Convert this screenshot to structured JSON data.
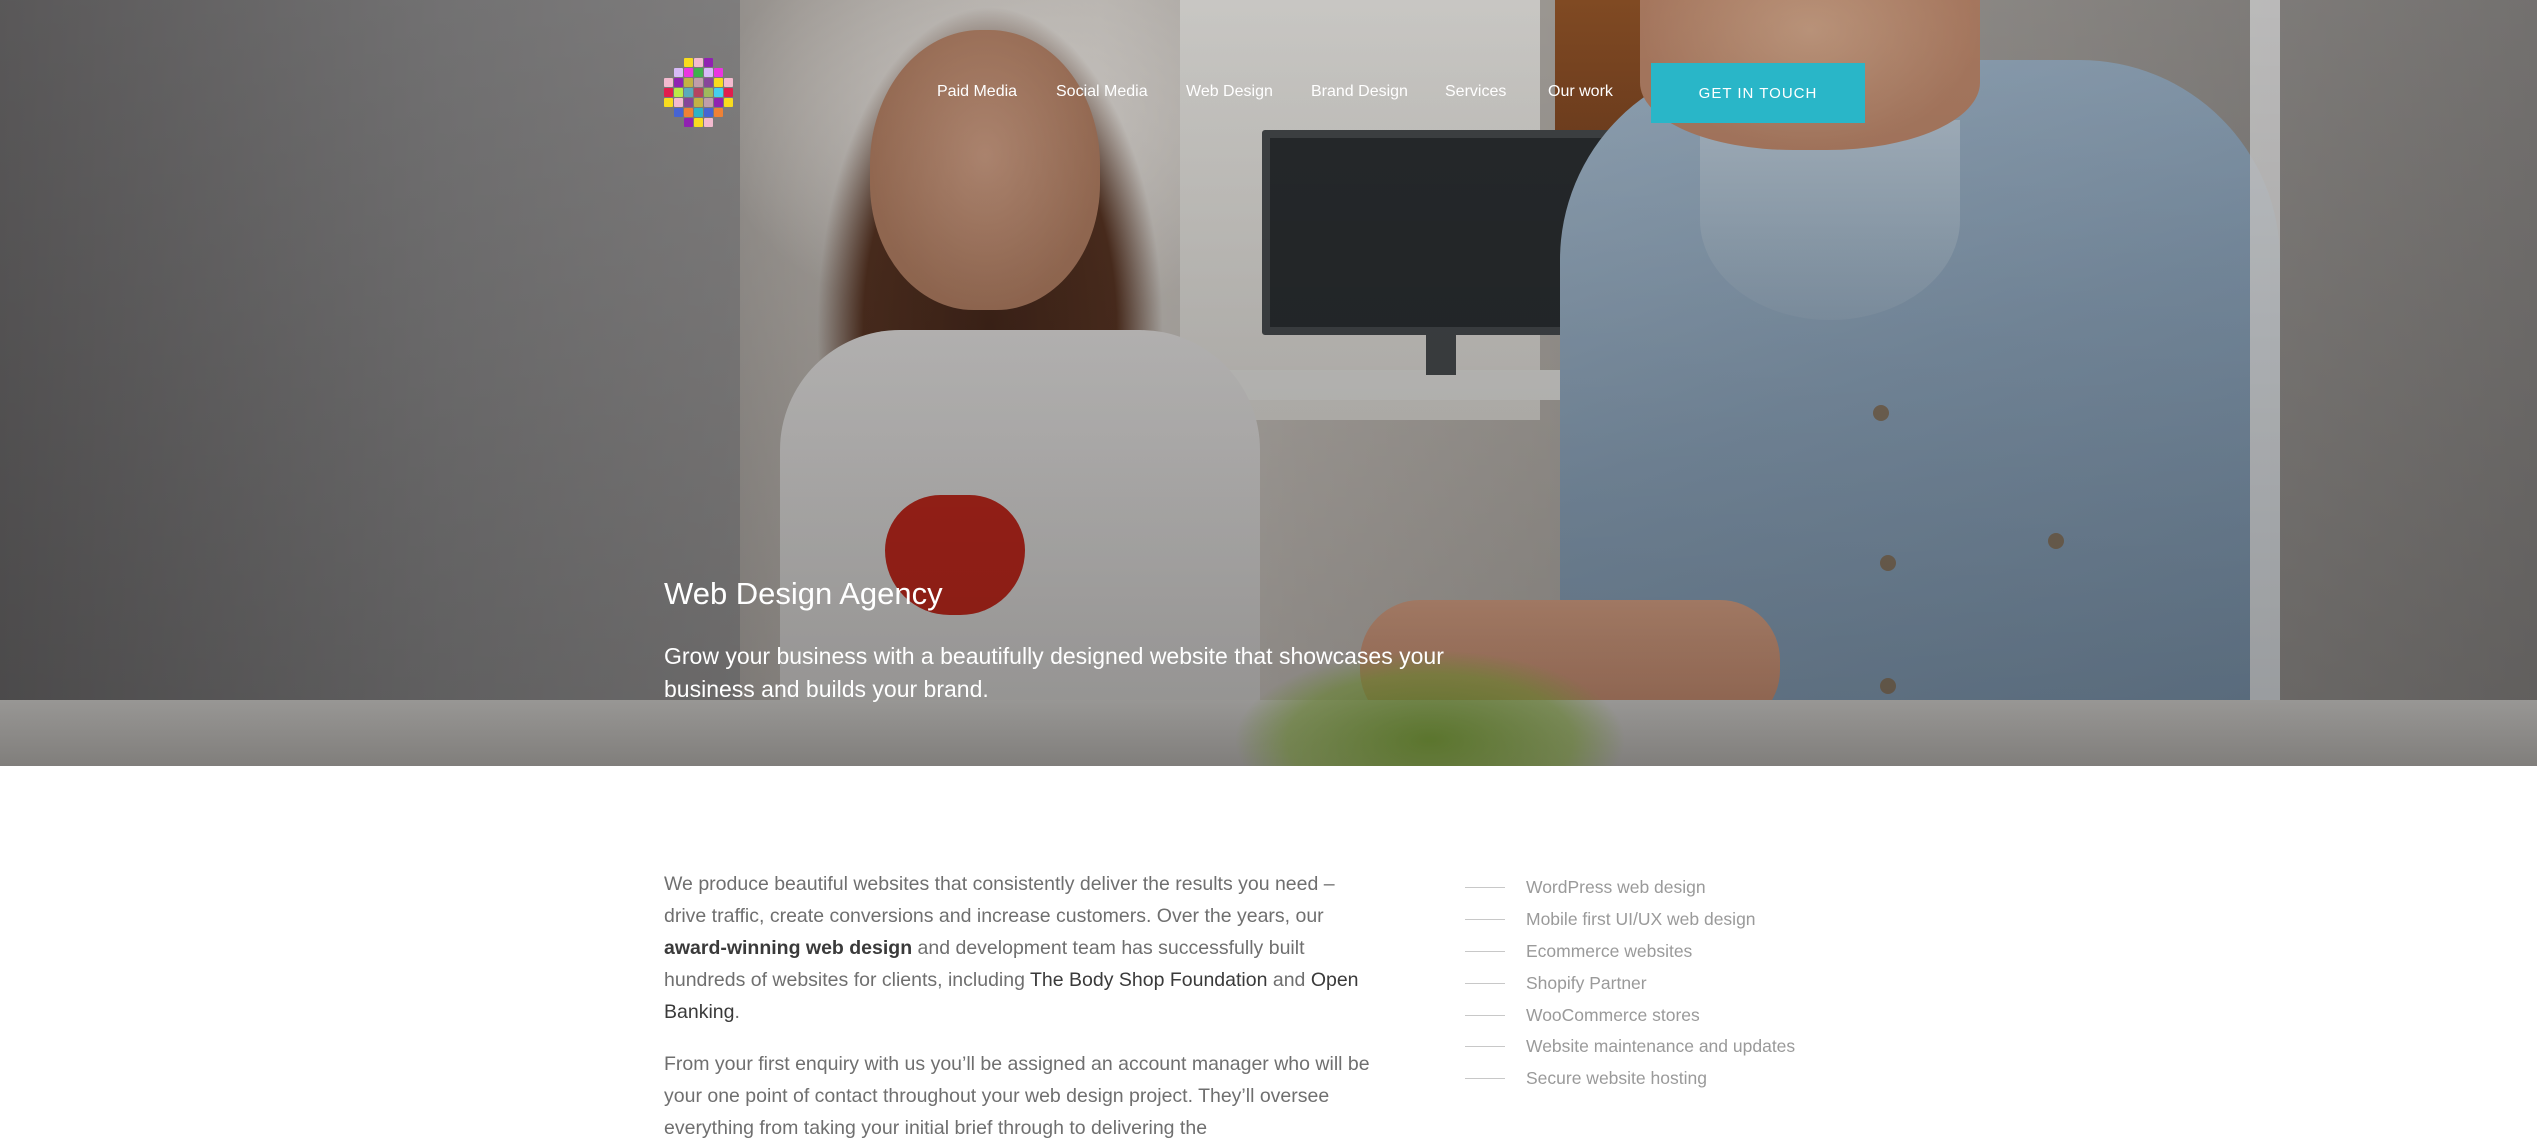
{
  "brand": {
    "accent": "#29b6c8"
  },
  "nav": {
    "items": [
      {
        "label": "Paid Media"
      },
      {
        "label": "Social Media"
      },
      {
        "label": "Web Design"
      },
      {
        "label": "Brand Design"
      },
      {
        "label": "Services"
      },
      {
        "label": "Our work"
      }
    ],
    "cta_label": "GET IN TOUCH"
  },
  "hero": {
    "title": "Web Design Agency",
    "subtitle": "Grow your business with a beautifully designed website that showcases your business and builds your brand."
  },
  "intro": {
    "p1_a": "We produce beautiful websites that consistently deliver the results you need – drive traffic, create conversions and increase customers. Over the years, our ",
    "p1_link": "award-winning web design",
    "p1_b": " and development team has successfully built hundreds of websites for clients, including ",
    "p1_client1": "The Body Shop Foundation",
    "p1_c": " and ",
    "p1_client2": "Open Banking",
    "p1_d": ".",
    "p2": "From your first enquiry with us you’ll be assigned an account manager who will be your one point of contact throughout your web design project. They’ll oversee everything from taking your initial brief through to delivering the"
  },
  "features": [
    "WordPress web design",
    "Mobile first UI/UX web design",
    "Ecommerce websites",
    "Shopify Partner",
    "WooCommerce stores",
    "Website maintenance and updates",
    "Secure website hosting"
  ]
}
